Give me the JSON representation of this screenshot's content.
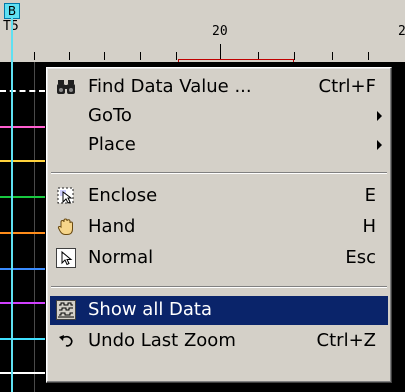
{
  "ruler": {
    "cursor_label": "B",
    "cursor_caption": "T5",
    "label_20": "20",
    "label_edge": "2"
  },
  "colors": {
    "cursor": "#5fe0f2",
    "highlight": "#0a246a",
    "menu_bg": "#d4d0c8",
    "marker": "#c00000"
  },
  "menu": {
    "items": [
      {
        "label": "Find Data Value ...",
        "shortcut": "Ctrl+F",
        "icon": "binoculars-icon"
      },
      {
        "label": "GoTo",
        "submenu": true
      },
      {
        "label": "Place",
        "submenu": true
      },
      {
        "label": "Enclose",
        "shortcut": "E",
        "icon": "enclose-icon"
      },
      {
        "label": "Hand",
        "shortcut": "H",
        "icon": "hand-icon"
      },
      {
        "label": "Normal",
        "shortcut": "Esc",
        "icon": "arrow-pointer-icon"
      },
      {
        "label": "Show all Data",
        "shortcut": "",
        "icon": "show-all-data-icon",
        "highlighted": true
      },
      {
        "label": "Undo Last Zoom",
        "shortcut": "Ctrl+Z",
        "icon": "undo-icon"
      }
    ]
  }
}
